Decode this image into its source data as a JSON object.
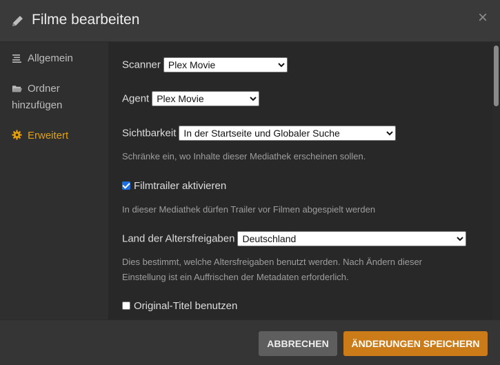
{
  "dialog": {
    "title": "Filme bearbeiten",
    "close_label": "×"
  },
  "sidebar": {
    "items": [
      {
        "label": "Allgemein",
        "icon": "list-icon",
        "active": false
      },
      {
        "label": "Ordner",
        "label2": "hinzufügen",
        "icon": "folder-icon",
        "active": false
      },
      {
        "label": "Erweitert",
        "icon": "gear-icon",
        "active": true
      }
    ]
  },
  "form": {
    "scanner": {
      "label": "Scanner",
      "value": "Plex Movie"
    },
    "agent": {
      "label": "Agent",
      "value": "Plex Movie"
    },
    "visibility": {
      "label": "Sichtbarkeit",
      "value": "In der Startseite und Globaler Suche",
      "help": "Schränke ein, wo Inhalte dieser Mediathek erscheinen sollen."
    },
    "trailers": {
      "label": "Filmtrailer aktivieren",
      "checked": true,
      "help": "In dieser Mediathek dürfen Trailer vor Filmen abgespielt werden"
    },
    "rating_country": {
      "label": "Land der Altersfreigaben",
      "value": "Deutschland",
      "help_line1": "Dies bestimmt, welche Altersfreigaben benutzt werden. Nach Ändern dieser",
      "help_line2": "Einstellung ist ein Auffrischen der Metadaten erforderlich."
    },
    "original_title": {
      "label": "Original-Titel benutzen",
      "checked": false
    }
  },
  "footer": {
    "cancel_label": "ABBRECHEN",
    "save_label": "ÄNDERUNGEN SPEICHERN"
  },
  "colors": {
    "accent": "#e5a00d",
    "save_button": "#cc7b19",
    "cancel_button": "#5e5e5e",
    "checkbox": "#1d6fe0"
  }
}
